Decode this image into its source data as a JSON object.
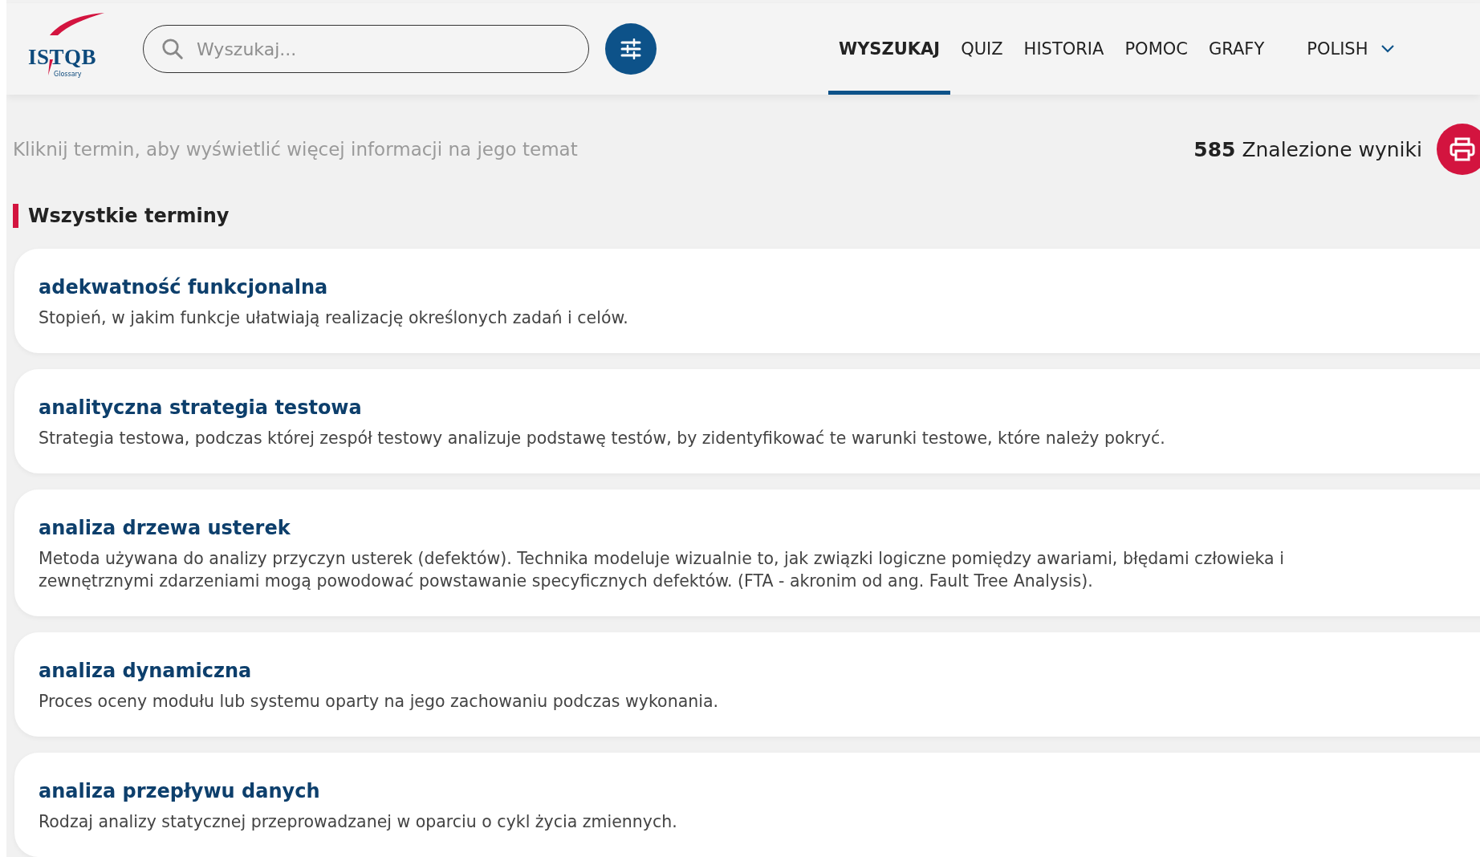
{
  "logo": {
    "name": "ISTQB",
    "subtitle": "Glossary"
  },
  "search": {
    "placeholder": "Wyszukaj..."
  },
  "nav": [
    {
      "label": "WYSZUKAJ",
      "selected": true
    },
    {
      "label": "QUIZ",
      "selected": false
    },
    {
      "label": "HISTORIA",
      "selected": false
    },
    {
      "label": "POMOC",
      "selected": false
    },
    {
      "label": "GRAFY",
      "selected": false
    }
  ],
  "language": "POLISH",
  "hint": "Kliknij termin, aby wyświetlić więcej informacji na jego temat",
  "results": {
    "count": "585",
    "label": "Znalezione wyniki"
  },
  "section_title": "Wszystkie terminy",
  "terms": [
    {
      "term": "adekwatność funkcjonalna",
      "definition": "Stopień, w jakim funkcje ułatwiają realizację określonych zadań i celów."
    },
    {
      "term": "analityczna strategia testowa",
      "definition": "Strategia testowa, podczas której zespół testowy analizuje podstawę testów, by zidentyfikować te warunki testowe, które należy pokryć."
    },
    {
      "term": "analiza drzewa usterek",
      "definition": "Metoda używana do analizy przyczyn usterek (defektów). Technika modeluje wizualnie to, jak związki logiczne pomiędzy awariami, błędami człowieka i zewnętrznymi zdarzeniami mogą powodować powstawanie specyficznych defektów. (FTA - akronim od ang. Fault Tree Analysis)."
    },
    {
      "term": "analiza dynamiczna",
      "definition": "Proces oceny modułu lub systemu oparty na jego zachowaniu podczas wykonania."
    },
    {
      "term": "analiza przepływu danych",
      "definition": "Rodzaj analizy statycznej przeprowadzanej w oparciu o cykl życia zmiennych."
    }
  ]
}
